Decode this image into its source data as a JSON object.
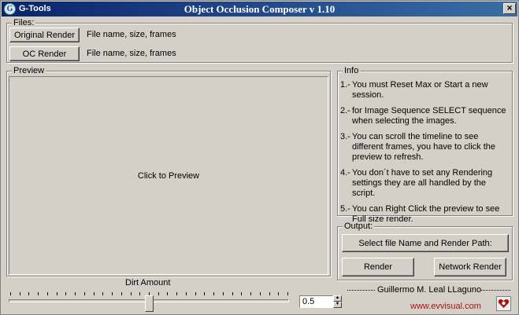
{
  "window": {
    "app_name": "G-Tools",
    "title": "Object Occlusion Composer v 1.10",
    "close_glyph": "×",
    "icon_glyph": "G"
  },
  "files": {
    "group_label": "Files:",
    "original_render_label": "Original Render",
    "original_render_info": "File name, size, frames",
    "oc_render_label": "OC Render",
    "oc_render_info": "File name, size, frames"
  },
  "preview": {
    "group_label": "Preview",
    "click_text": "Click to Preview"
  },
  "info": {
    "group_label": "Info",
    "items": [
      {
        "num": "1.-",
        "text": "You must Reset Max or Start a new session."
      },
      {
        "num": "2.-",
        "text": "for Image Sequence SELECT sequence when selecting the images."
      },
      {
        "num": "3.-",
        "text": "You can scroll the timeline to see different frames, you have to click the preview to refresh."
      },
      {
        "num": "4.-",
        "text": "You don´t have to set any Rendering settings they are all handled by the script."
      },
      {
        "num": "5.-",
        "text": "You can Right Click the preview to see Full size render."
      }
    ]
  },
  "output": {
    "group_label": "Output:",
    "select_path_label": "Select file Name and Render Path:",
    "render_label": "Render",
    "network_render_label": "Network Render"
  },
  "dirt": {
    "label": "Dirt Amount",
    "value": "0.5",
    "slider_fraction": 0.5
  },
  "credits": {
    "author": "Guillermo M. Leal LLaguno",
    "website": "www.evvisual.com"
  },
  "colors": {
    "title_start": "#0a246a",
    "title_end": "#3a6ea5",
    "website": "#b01010",
    "face": "#d4d0c8"
  }
}
